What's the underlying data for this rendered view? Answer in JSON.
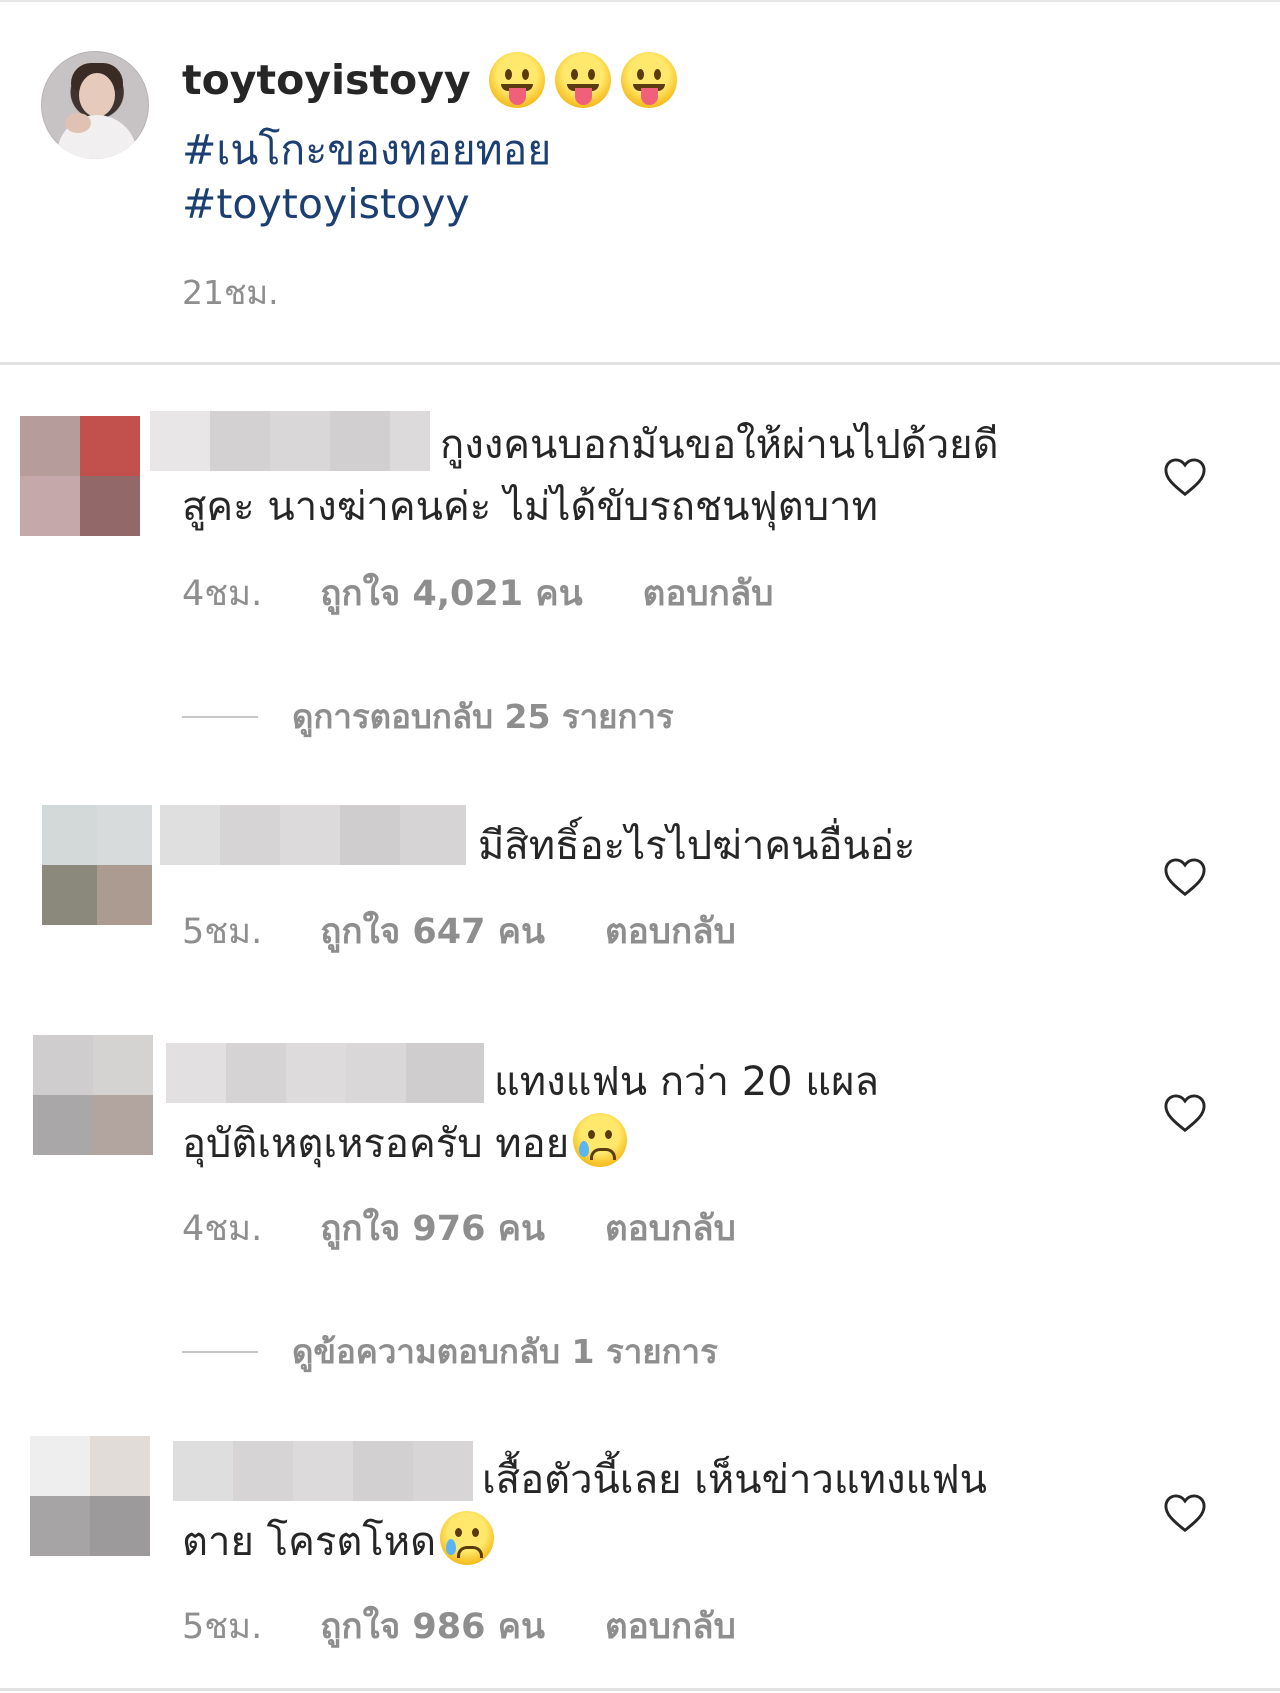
{
  "caption": {
    "username": "toytoyistoyy",
    "emoji_icons": [
      "tongue-out-emoji",
      "tongue-out-emoji",
      "tongue-out-emoji"
    ],
    "hashtag_1": "#เนโกะของทอยทอย",
    "hashtag_2": "#toytoyistoyy",
    "time": "21ชม."
  },
  "comments": [
    {
      "text_line1": "กูงงคนบอกมันขอให้ผ่านไปด้วยดี",
      "text_line2": "สูคะ นางฆ่าคนค่ะ ไม่ได้ขับรถชนฟุตบาท",
      "time": "4ชม.",
      "likes": "ถูกใจ 4,021 คน",
      "reply": "ตอบกลับ",
      "view_replies": "ดูการตอบกลับ 25 รายการ"
    },
    {
      "text_line1": "มีสิทธิ์อะไรไปฆ่าคนอื่นอ่ะ",
      "time": "5ชม.",
      "likes": "ถูกใจ 647 คน",
      "reply": "ตอบกลับ"
    },
    {
      "text_line1": "แทงแฟน กว่า 20 แผล",
      "text_line2": "อุบัติเหตุเหรอครับ ทอย",
      "time": "4ชม.",
      "likes": "ถูกใจ 976 คน",
      "reply": "ตอบกลับ",
      "view_replies": "ดูข้อความตอบกลับ 1 รายการ"
    },
    {
      "text_line1": "เสื้อตัวนี้เลย เห็นข่าวแทงแฟน",
      "text_line2": "ตาย โครตโหด",
      "time": "5ชม.",
      "likes": "ถูกใจ 986 คน",
      "reply": "ตอบกลับ"
    }
  ],
  "icons": {
    "like": "heart-outline-icon",
    "comment_emoji": "crying-face-emoji"
  },
  "colors": {
    "hashtag": "#1c3f73",
    "meta_gray": "#8e8e8e",
    "text": "#262626"
  }
}
